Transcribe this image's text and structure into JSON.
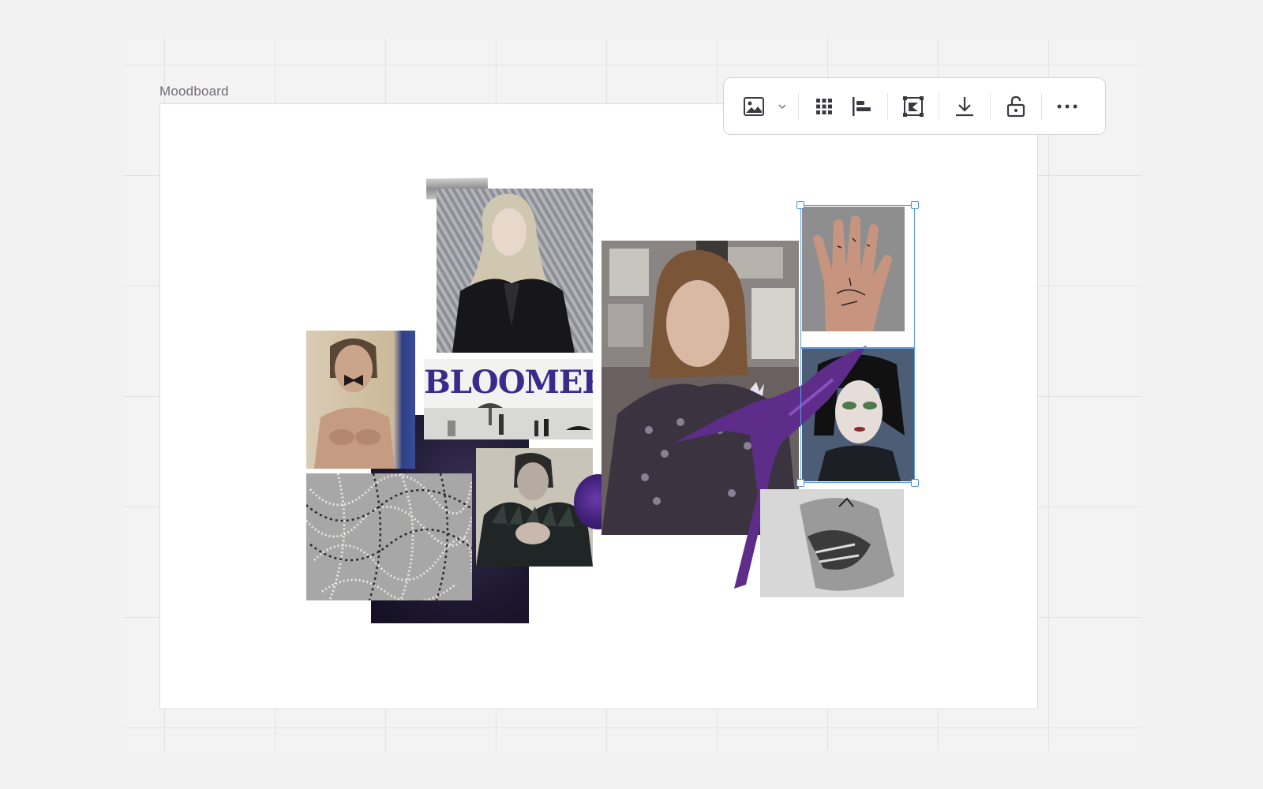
{
  "frame": {
    "label": "Moodboard"
  },
  "collage": {
    "bloomers_title": "BLOOMERS"
  },
  "colors": {
    "accent_purple": "#3a2a8c",
    "selection_blue": "#5b9de6",
    "toolbar_icon": "#3b3940"
  },
  "toolbar": {
    "icons": [
      "image-icon",
      "chevron-down-icon",
      "grid-icon",
      "align-left-icon",
      "crop-icon",
      "download-icon",
      "unlock-icon",
      "more-icon"
    ]
  }
}
